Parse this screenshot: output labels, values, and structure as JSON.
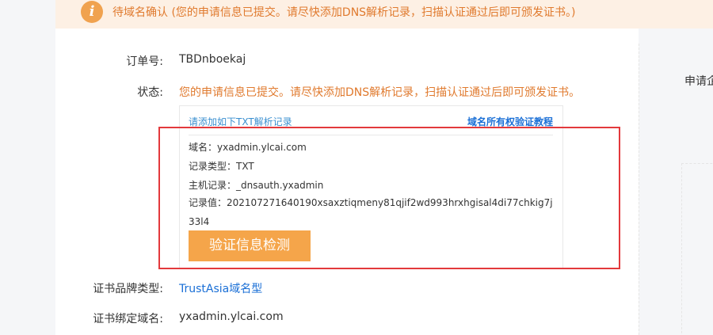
{
  "banner": {
    "text": "待域名确认 (您的申请信息已提交。请尽快添加DNS解析记录，扫描认证通过后即可颁发证书。)",
    "icon": "info-icon",
    "color": "#e07a2e"
  },
  "order": {
    "label": "订单号:",
    "value": "TBDnboekaj"
  },
  "status": {
    "label": "状态:",
    "value": "您的申请信息已提交。请尽快添加DNS解析记录，扫描认证通过后即可颁发证书。"
  },
  "dns_box": {
    "header_left": "请添加如下TXT解析记录",
    "header_right": "域名所有权验证教程",
    "domain": "域名：yxadmin.ylcai.com",
    "record_type": "记录类型：TXT",
    "host": "主机记录：_dnsauth.yxadmin",
    "record_value": "记录值：202107271640190xsaxztiqmeny81qjif2wd993hrxhgisal4di77chkig7j33l4",
    "verify_button": "验证信息检测"
  },
  "brand": {
    "label": "证书品牌类型:",
    "value": "TrustAsia域名型"
  },
  "bound_domain": {
    "label": "证书绑定域名:",
    "value": "yxadmin.ylcai.com"
  },
  "side": {
    "label": "申请企"
  },
  "colors": {
    "accent_orange": "#f5a54a",
    "link_blue": "#1a6fd6",
    "highlight_red": "#e3393c"
  }
}
